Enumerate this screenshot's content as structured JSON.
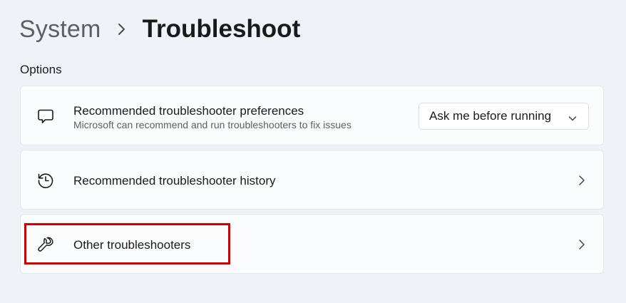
{
  "breadcrumb": {
    "parent": "System",
    "current": "Troubleshoot"
  },
  "section_label": "Options",
  "cards": [
    {
      "icon": "feedback-message-icon",
      "title": "Recommended troubleshooter preferences",
      "subtitle": "Microsoft can recommend and run troubleshooters to fix issues",
      "dropdown_value": "Ask me before running"
    },
    {
      "icon": "history-icon",
      "title": "Recommended troubleshooter history"
    },
    {
      "icon": "wrench-icon",
      "title": "Other troubleshooters",
      "highlighted": true
    }
  ],
  "colors": {
    "page_background": "#eff3f8",
    "card_background": "#fbfcfe",
    "highlight": "#d40000"
  }
}
